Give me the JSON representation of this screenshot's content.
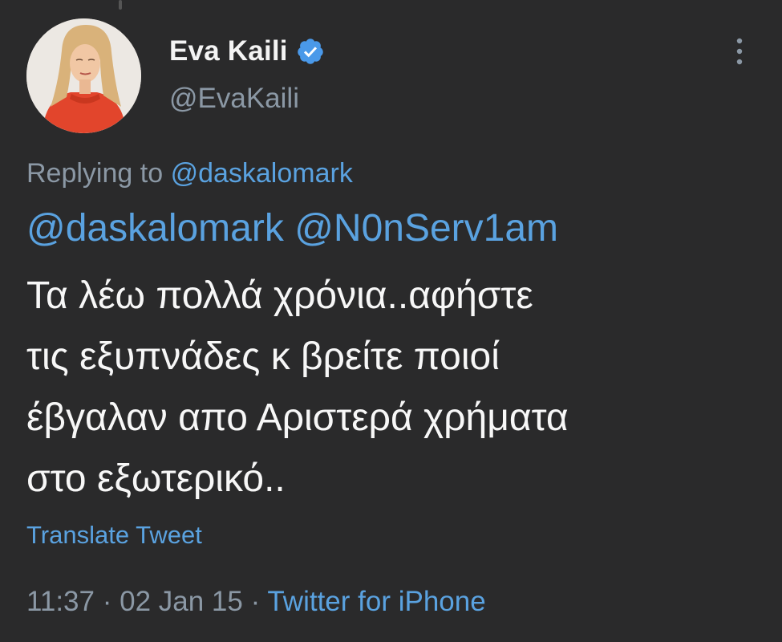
{
  "author": {
    "display_name": "Eva Kaili",
    "handle": "@EvaKaili",
    "verified": true
  },
  "reply": {
    "prefix": "Replying to",
    "to": "@daskalomark"
  },
  "tweet": {
    "mentions": [
      "@daskalomark",
      "@N0nServ1am"
    ],
    "lines": [
      "Τα λέω πολλά χρόνια..αφήστε",
      "τις εξυπνάδες κ βρείτε ποιοί",
      "έβγαλαν απο Αριστερά χρήματα",
      "στο εξωτερικό.."
    ]
  },
  "translate_label": "Translate Tweet",
  "meta": {
    "time": "11:37",
    "sep": " · ",
    "date": "02 Jan 15",
    "source": "Twitter for iPhone"
  },
  "colors": {
    "background": "#2a2a2b",
    "link": "#5aa2e0",
    "secondary_text": "#8b98a5",
    "primary_text": "#f7f7f7",
    "verified": "#4a99e9"
  },
  "icons": {
    "verified": "verified-badge-icon",
    "more": "more-vertical-icon"
  }
}
